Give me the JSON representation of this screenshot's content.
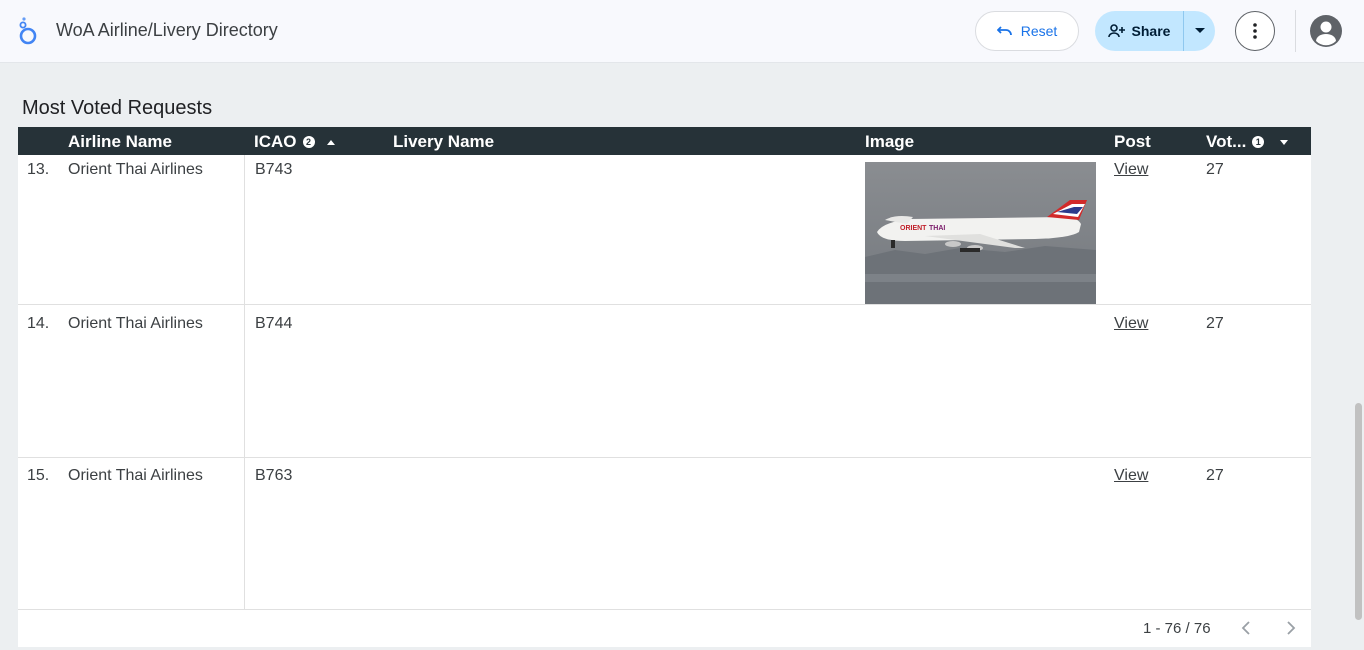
{
  "header": {
    "app_title": "WoA Airline/Livery Directory",
    "reset_label": "Reset",
    "share_label": "Share",
    "accent_color": "#1a73e8",
    "share_bg": "#c2e7ff"
  },
  "section": {
    "title": "Most Voted Requests"
  },
  "table": {
    "columns": [
      {
        "label": "Airline Name"
      },
      {
        "label": "ICAO",
        "badge": "2",
        "sort": "asc"
      },
      {
        "label": "Livery Name"
      },
      {
        "label": "Image"
      },
      {
        "label": "Post"
      },
      {
        "label": "Vot...",
        "badge": "1",
        "sort": "desc"
      }
    ],
    "rows": [
      {
        "index": "13.",
        "airline": "Orient Thai Airlines",
        "icao": "B743",
        "livery": "",
        "has_image": true,
        "post": "View",
        "votes": "27"
      },
      {
        "index": "14.",
        "airline": "Orient Thai Airlines",
        "icao": "B744",
        "livery": "",
        "has_image": false,
        "post": "View",
        "votes": "27"
      },
      {
        "index": "15.",
        "airline": "Orient Thai Airlines",
        "icao": "B763",
        "livery": "",
        "has_image": false,
        "post": "View",
        "votes": "27"
      }
    ],
    "pagination": "1 - 76 / 76",
    "header_bg": "#263238"
  },
  "icons": [
    "looker-studio-logo",
    "undo-icon",
    "add-person-icon",
    "caret-down-icon",
    "more-vert-icon",
    "account-circle-icon",
    "chevron-left-icon",
    "chevron-right-icon"
  ]
}
